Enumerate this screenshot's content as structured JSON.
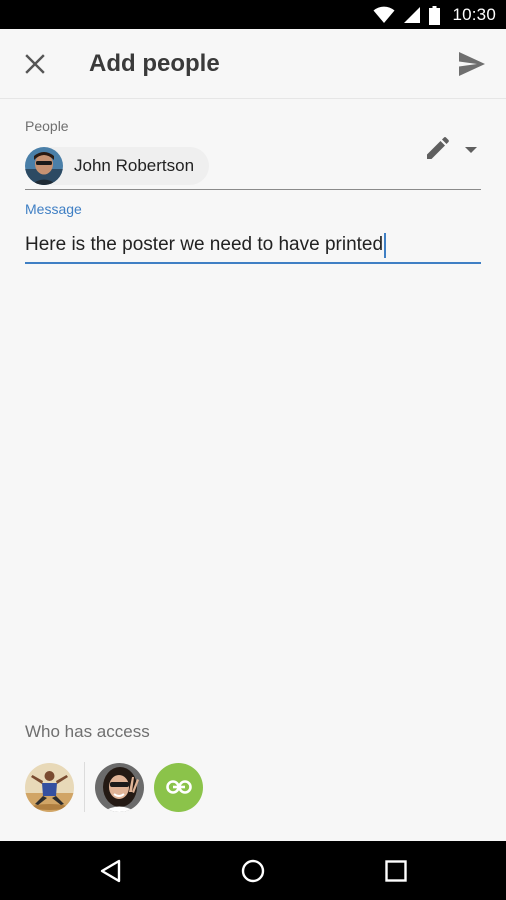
{
  "status_bar": {
    "time": "10:30"
  },
  "app_bar": {
    "title": "Add people"
  },
  "people": {
    "label": "People",
    "recipients": [
      {
        "name": "John Robertson"
      }
    ]
  },
  "message": {
    "label": "Message",
    "value": "Here is the poster we need to have printed"
  },
  "access": {
    "label": "Who has access"
  },
  "colors": {
    "accent": "#3f7fc4",
    "link_button": "#8bc34a",
    "title": "#3a3a3a"
  },
  "icons": [
    "wifi-icon",
    "signal-icon",
    "battery-icon",
    "close-icon",
    "send-icon",
    "edit-icon",
    "dropdown-icon",
    "link-icon",
    "back-icon",
    "home-icon",
    "recents-icon"
  ]
}
